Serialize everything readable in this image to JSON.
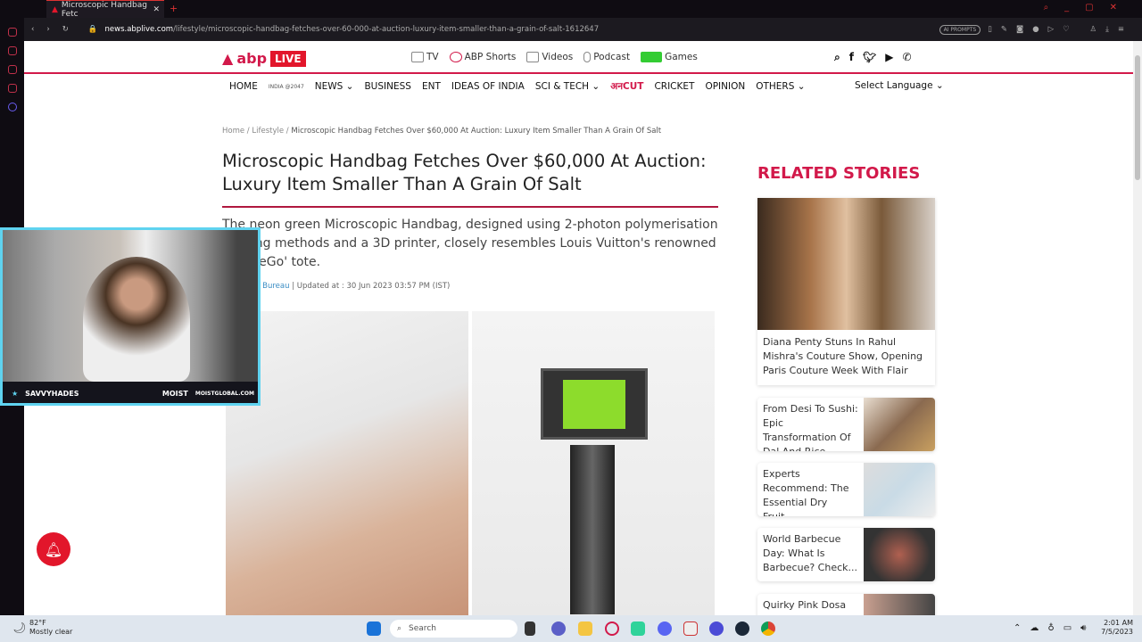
{
  "browser": {
    "tab_title": "Microscopic Handbag Fetc",
    "url_host": "news.abplive.com",
    "url_path": "/lifestyle/microscopic-handbag-fetches-over-60-000-at-auction-luxury-item-smaller-than-a-grain-of-salt-1612647",
    "ai_prompts": "AI PROMPTS"
  },
  "site": {
    "logo": "abp",
    "logo_live": "LIVE",
    "media": [
      "TV",
      "ABP Shorts",
      "Videos",
      "Podcast",
      "Games"
    ],
    "nav": [
      "HOME",
      "INDIA @2047",
      "NEWS ⌄",
      "BUSINESS",
      "ENT",
      "IDEAS OF INDIA",
      "SCI & TECH ⌄",
      "अनCUT",
      "CRICKET",
      "OPINION",
      "OTHERS ⌄"
    ],
    "language": "Select Language ⌄"
  },
  "article": {
    "breadcrumb": [
      "Home",
      "Lifestyle",
      "Microscopic Handbag Fetches Over $60,000 At Auction: Luxury Item Smaller Than A Grain Of Salt"
    ],
    "title": "Microscopic Handbag Fetches Over $60,000 At Auction: Luxury Item Smaller Than A Grain Of Salt",
    "lede": "The neon green Microscopic Handbag, designed using 2-photon polymerisation printing methods and a 3D printer, closely resembles Louis Vuitton's renowned 'OnTheGo' tote.",
    "source": "ABP News Bureau",
    "updated": " | Updated at : 30 Jun 2023 03:57 PM (IST)"
  },
  "related": {
    "heading": "RELATED STORIES",
    "stories": [
      "Diana Penty Stuns In Rahul Mishra's Couture Show, Opening Paris Couture Week With Flair",
      "From Desi To Sushi: Epic Transformation Of Dal And Rice...",
      "Experts Recommend: The Essential Dry Fruit...",
      "World Barbecue Day: What Is Barbecue? Check...",
      "Quirky Pink Dosa"
    ]
  },
  "stream": {
    "user": "SAVVYHADES",
    "brand": "MOIST",
    "site": "MOISTGLOBAL.COM"
  },
  "taskbar": {
    "temp": "82°F",
    "weather": "Mostly clear",
    "search": "Search",
    "time": "2:01 AM",
    "date": "7/5/2023"
  }
}
